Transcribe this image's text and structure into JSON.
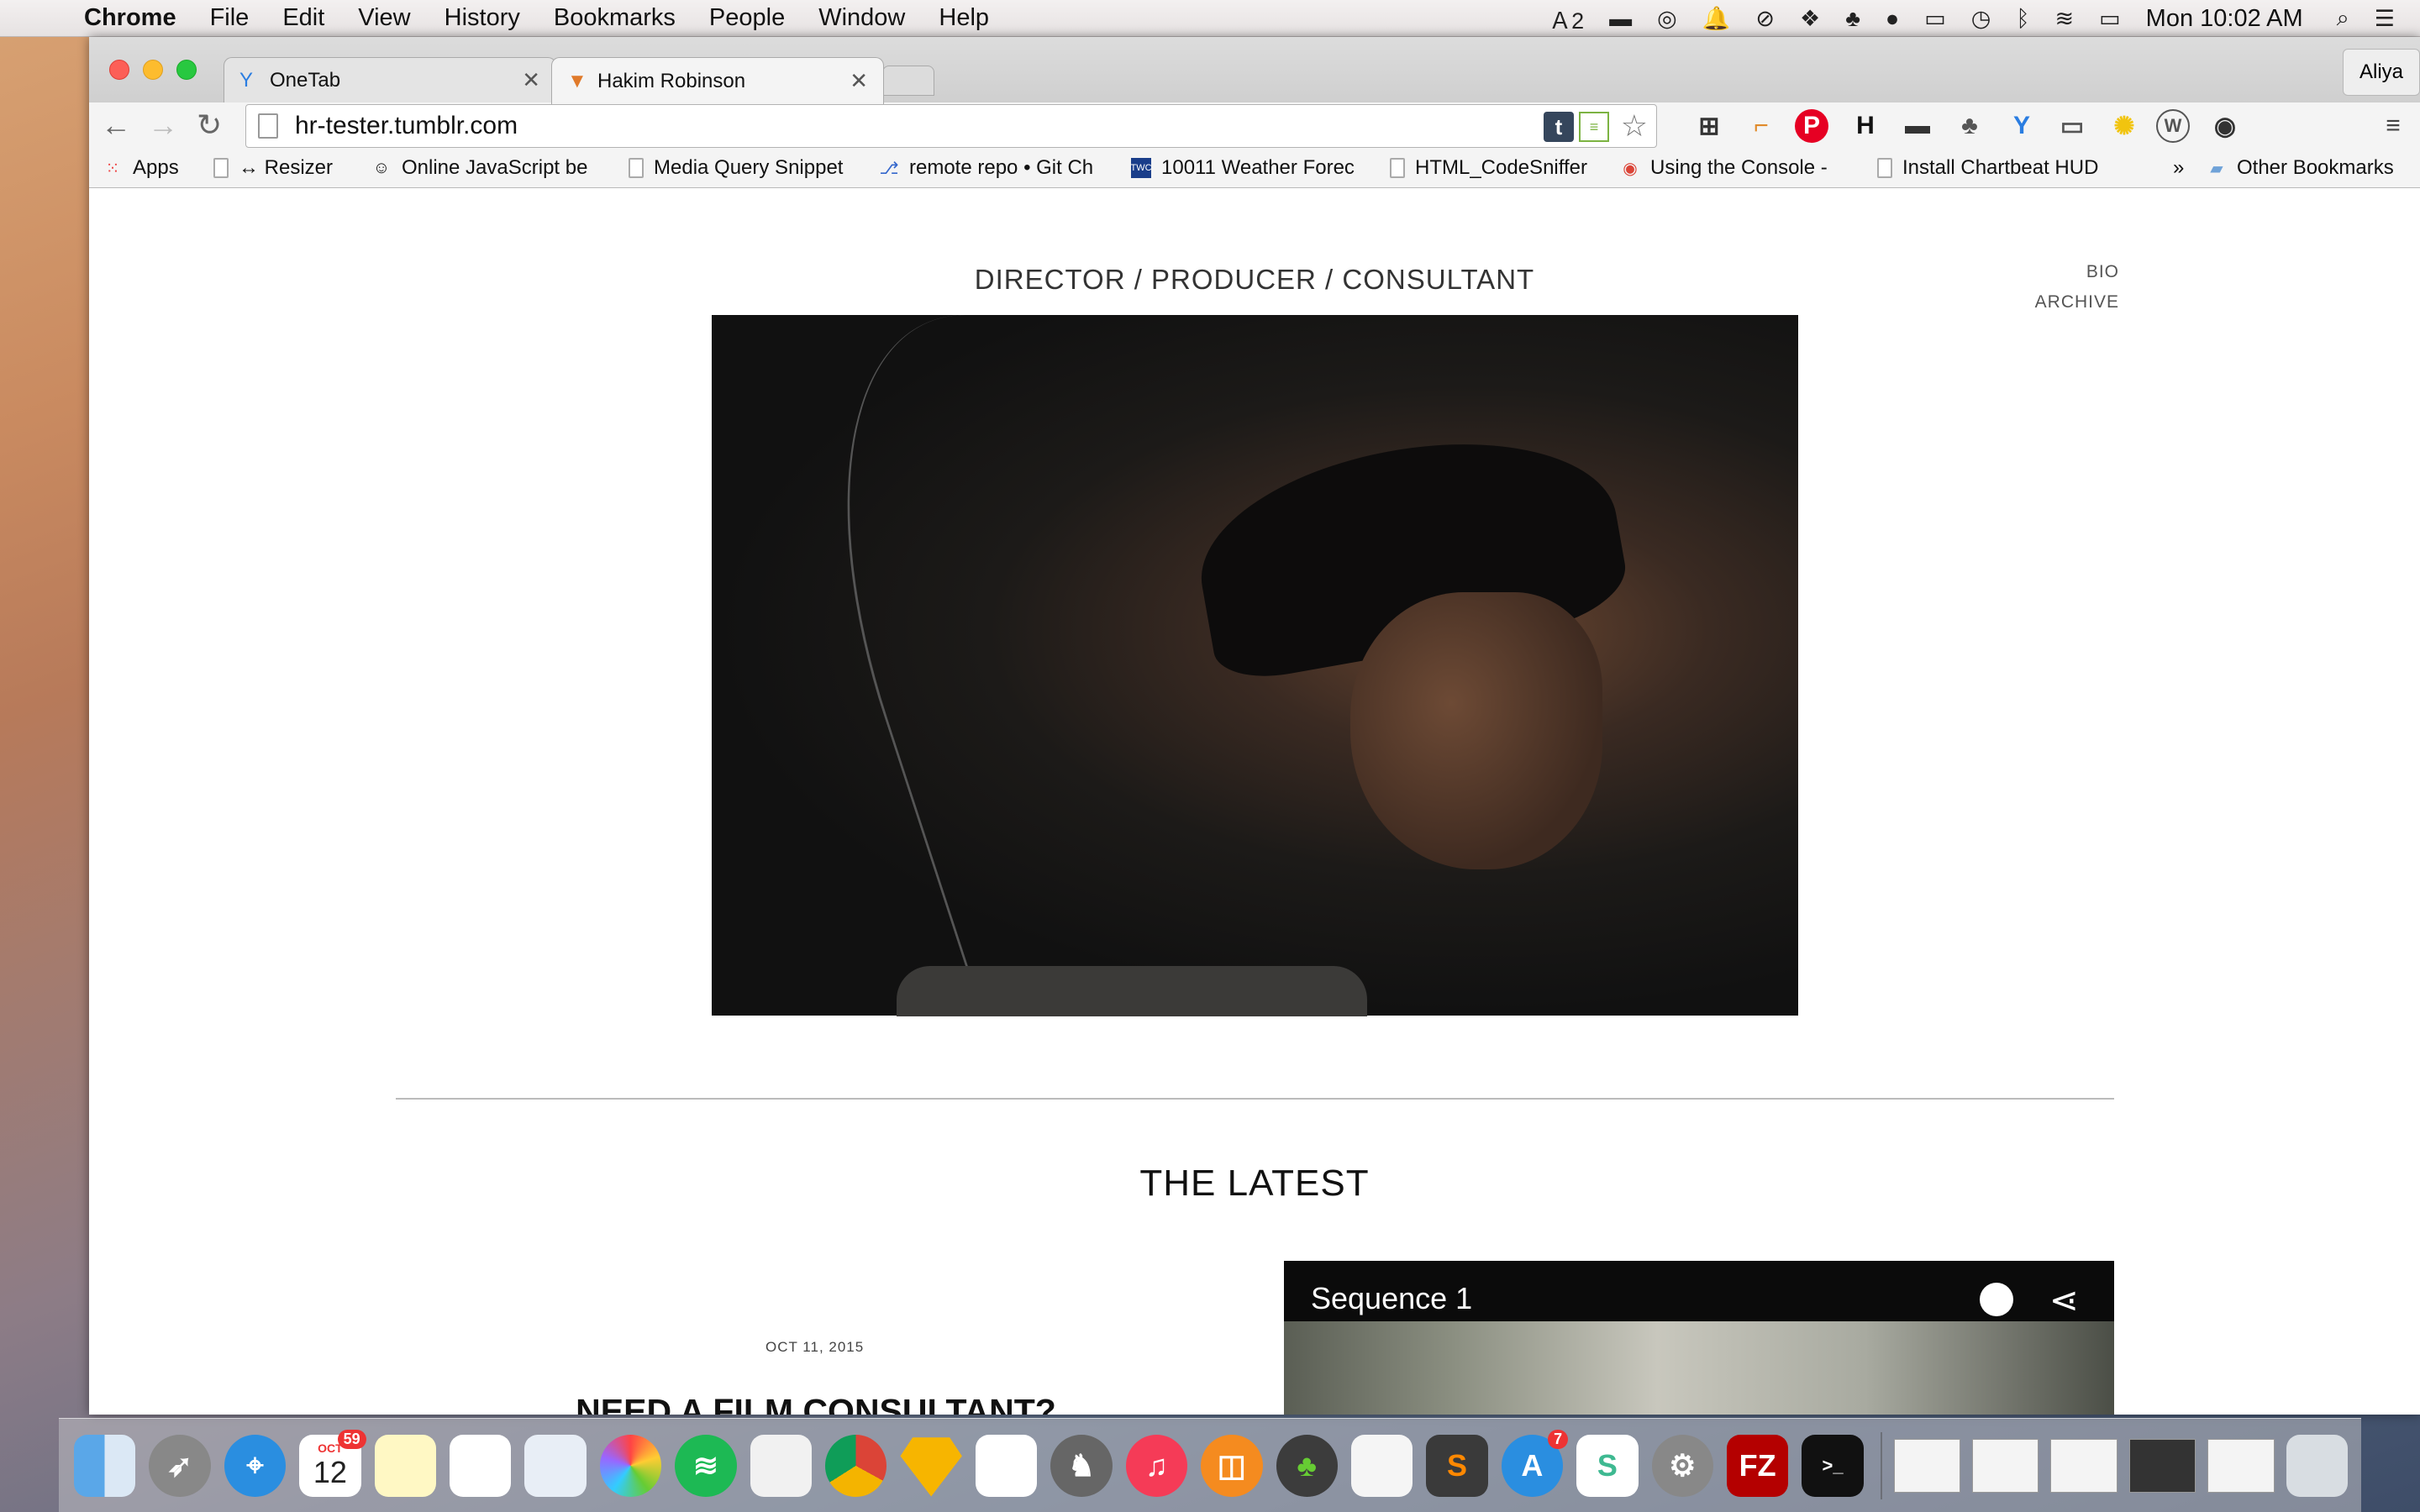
{
  "menubar": {
    "app": "Chrome",
    "menus": [
      "File",
      "Edit",
      "View",
      "History",
      "Bookmarks",
      "People",
      "Window",
      "Help"
    ],
    "adobe_count": "2",
    "clock": "Mon 10:02 AM"
  },
  "tabs": [
    {
      "title": "OneTab",
      "icon": "onetab-icon"
    },
    {
      "title": "Hakim Robinson",
      "icon": "tumblr-theme-icon"
    }
  ],
  "profile": "Aliya",
  "address": "hr-tester.tumblr.com",
  "bookmarks": [
    {
      "label": "Apps"
    },
    {
      "label": "↔ Resizer"
    },
    {
      "label": "Online JavaScript be"
    },
    {
      "label": "Media Query Snippet"
    },
    {
      "label": "remote repo • Git Ch"
    },
    {
      "label": "10011 Weather Forec"
    },
    {
      "label": "HTML_CodeSniffer"
    },
    {
      "label": "Using the Console -"
    },
    {
      "label": "Install Chartbeat HUD"
    },
    {
      "label": "»"
    },
    {
      "label": "Other Bookmarks"
    }
  ],
  "page": {
    "tagline": "DIRECTOR / PRODUCER / CONSULTANT",
    "nav": [
      "BIO",
      "ARCHIVE"
    ],
    "section_title": "THE LATEST",
    "post": {
      "date": "OCT 11, 2015",
      "title": "NEED A FILM CONSULTANT?"
    },
    "video": {
      "title": "Sequence 1"
    }
  },
  "dock": {
    "calendar": {
      "month": "OCT",
      "day": "12",
      "badge": "59"
    },
    "appstore_badge": "7",
    "filezilla": "FZ"
  }
}
